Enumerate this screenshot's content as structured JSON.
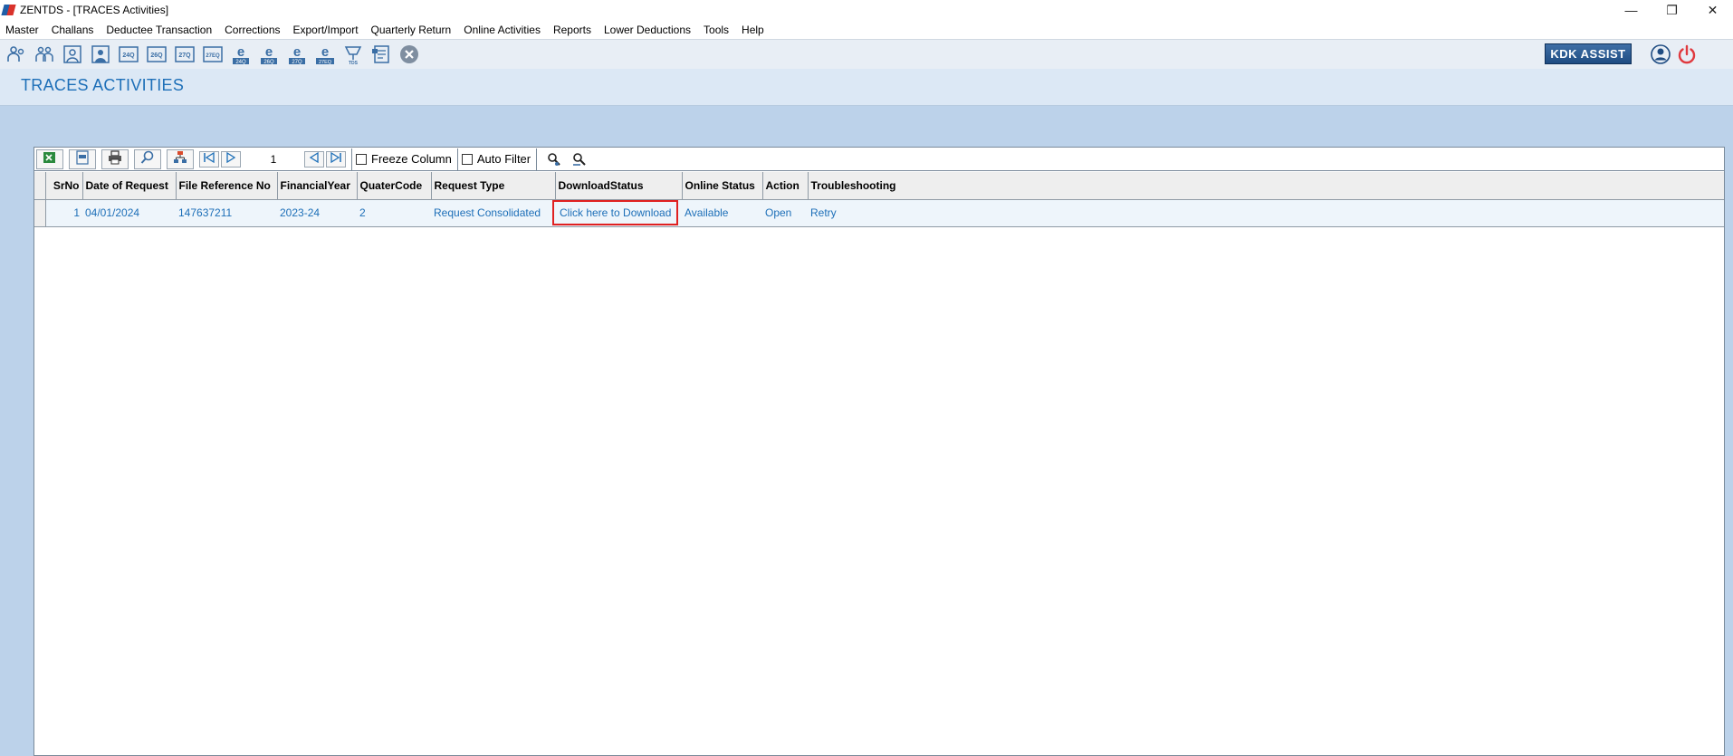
{
  "window": {
    "title": "ZENTDS - [TRACES Activities]",
    "minimize": "—",
    "restore": "❐",
    "close": "✕"
  },
  "menu": [
    "Master",
    "Challans",
    "Deductee Transaction",
    "Corrections",
    "Export/Import",
    "Quarterly Return",
    "Online Activities",
    "Reports",
    "Lower Deductions",
    "Tools",
    "Help"
  ],
  "toolbar": {
    "icons": [
      "deductor-icon",
      "deductee-icon",
      "employee-icon",
      "person-icon",
      "form-24q-icon",
      "form-26q-icon",
      "form-27q-icon",
      "form-27eq-icon",
      "e-24q-icon",
      "e-26q-icon",
      "e-27q-icon",
      "e-27eq-icon",
      "tds-icon",
      "report-icon",
      "close-circle-icon"
    ],
    "form_labels": [
      "24Q",
      "26Q",
      "27Q",
      "27EQ"
    ],
    "e_labels": [
      "24Q",
      "26Q",
      "27Q",
      "27EQ"
    ],
    "tds_label": "TDS",
    "kdk_assist": "KDK ASSIST",
    "accent": "#1f4c82"
  },
  "page": {
    "title": "TRACES ACTIVITIES"
  },
  "grid_toolbar": {
    "page_number": "1",
    "freeze_column": "Freeze Column",
    "auto_filter": "Auto Filter"
  },
  "table": {
    "columns": [
      "SrNo",
      "Date of Request",
      "File Reference No",
      "FinancialYear",
      "QuaterCode",
      "Request Type",
      "DownloadStatus",
      "Online Status",
      "Action",
      "Troubleshooting"
    ],
    "rows": [
      {
        "srno": "1",
        "date": "04/01/2024",
        "file_ref": "147637211",
        "fy": "2023-24",
        "quarter": "2",
        "request_type": "Request Consolidated",
        "download_status": "Click here to Download",
        "online_status": "Available",
        "action": "Open",
        "troubleshooting": "Retry"
      }
    ]
  },
  "colors": {
    "link": "#1d6fb8",
    "highlight": "#e02020",
    "background": "#bcd2ea"
  }
}
